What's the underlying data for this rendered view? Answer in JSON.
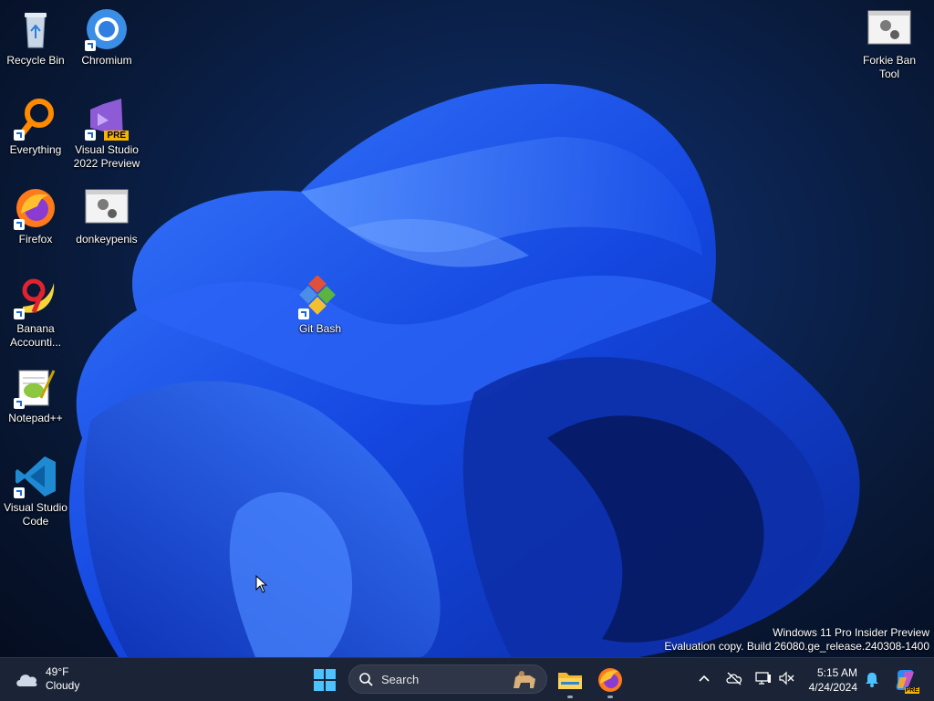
{
  "desktop": {
    "icons": [
      {
        "label": "Recycle Bin",
        "icon": "recycle-bin-icon"
      },
      {
        "label": "Chromium",
        "icon": "chromium-icon"
      },
      {
        "label": "Everything",
        "icon": "everything-icon"
      },
      {
        "label": "Visual Studio 2022 Preview",
        "icon": "visual-studio-preview-icon",
        "badge": "PRE"
      },
      {
        "label": "Firefox",
        "icon": "firefox-icon"
      },
      {
        "label": "donkeypenis",
        "icon": "app-window-gear-icon"
      },
      {
        "label": "Banana Accounti...",
        "icon": "banana-accounting-icon"
      },
      {
        "label": "Notepad++",
        "icon": "notepad-plus-plus-icon"
      },
      {
        "label": "Visual Studio Code",
        "icon": "vscode-icon"
      },
      {
        "label": "Git Bash",
        "icon": "git-bash-icon"
      },
      {
        "label": "Forkie Ban Tool",
        "icon": "app-window-gear-icon"
      }
    ]
  },
  "watermark": {
    "line1": "Windows 11 Pro Insider Preview",
    "line2": "Evaluation copy. Build 26080.ge_release.240308-1400"
  },
  "taskbar": {
    "weather": {
      "temp": "49°F",
      "condition": "Cloudy",
      "icon": "cloud-icon"
    },
    "search_placeholder": "Search",
    "pinned": [
      "start-icon",
      "file-explorer-icon",
      "firefox-icon"
    ],
    "tray_icons": [
      "chevron-up-icon",
      "onedrive-offline-icon",
      "network-icon",
      "volume-muted-icon",
      "bell-icon",
      "copilot-icon"
    ],
    "copilot_badge": "PRE",
    "clock": {
      "time": "5:15 AM",
      "date": "4/24/2024"
    }
  },
  "colors": {
    "accent": "#4cc2ff",
    "taskbar": "#1b2436"
  }
}
